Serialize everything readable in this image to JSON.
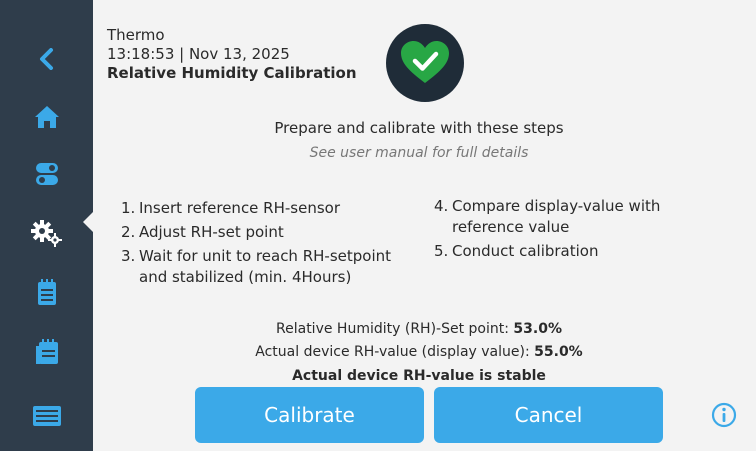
{
  "colors": {
    "sidebar": "#2f3d4b",
    "accent": "#3ba9e8",
    "status_bg": "#1f2c38",
    "status_ok": "#28a745"
  },
  "sidebar": {
    "items": [
      {
        "icon": "back-chevron-icon"
      },
      {
        "icon": "home-icon"
      },
      {
        "icon": "toggle-switches-icon"
      },
      {
        "icon": "gears-icon",
        "active": true
      },
      {
        "icon": "notepad-icon"
      },
      {
        "icon": "log-icon"
      },
      {
        "icon": "display-icon"
      }
    ]
  },
  "header": {
    "device": "Thermo",
    "datetime": "13:18:53 | Nov 13, 2025",
    "title": "Relative Humidity Calibration"
  },
  "status": {
    "icon": "heart-check-icon"
  },
  "intro": {
    "line": "Prepare and calibrate with these steps",
    "note": "See user manual for full details"
  },
  "steps_left": [
    {
      "num": "1.",
      "text": "Insert reference RH-sensor"
    },
    {
      "num": "2.",
      "text": "Adjust RH-set point"
    },
    {
      "num": "3.",
      "text": "Wait for unit to reach RH-setpoint and stabilized (min. 4Hours)"
    }
  ],
  "steps_right": [
    {
      "num": "4.",
      "text": "Compare display-value with reference value"
    },
    {
      "num": "5.",
      "text": "Conduct calibration"
    }
  ],
  "readout": {
    "setpoint_label": "Relative Humidity (RH)-Set point:",
    "setpoint_value": "53.0%",
    "actual_label": "Actual device RH-value (display value):",
    "actual_value": "55.0%",
    "stable_text": "Actual device RH-value is stable"
  },
  "buttons": {
    "calibrate": "Calibrate",
    "cancel": "Cancel"
  },
  "info": {
    "icon": "info-icon"
  }
}
